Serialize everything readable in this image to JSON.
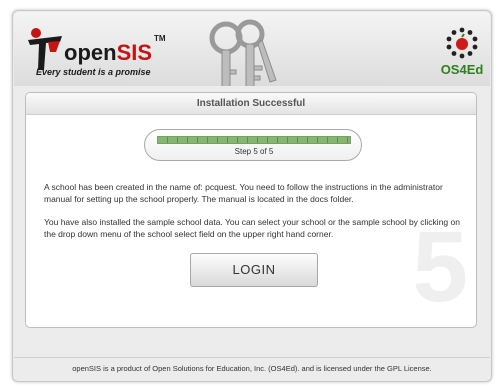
{
  "header": {
    "logo_prefix": "open",
    "logo_suffix": "SIS",
    "logo_tm": "TM",
    "tagline": "Every student is a promise",
    "partner_label": "OS4Ed"
  },
  "panel": {
    "title": "Installation Successful",
    "progress": {
      "completed_steps": 5,
      "total_steps": 5,
      "label": "Step 5 of 5"
    },
    "paragraph1": "A school has been created in the name of: pcquest. You need to follow the instructions in the administrator manual for setting up the school properly. The manual is located in the docs folder.",
    "paragraph2": "You have also installed the sample school data. You can select your school or the sample school by clicking on the drop down menu of the school select field on the upper right hand corner.",
    "big_step_number": "5",
    "login_label": "LOGIN"
  },
  "footer": {
    "text": "openSIS is a product of Open Solutions for Education, Inc. (OS4Ed). and is licensed under the GPL License."
  },
  "colors": {
    "brand_red": "#c41414",
    "progress_green": "#84b86c",
    "partner_green": "#2f7f1f"
  },
  "icons": [
    "person-logo-icon",
    "keys-icon",
    "os4ed-apple-icon"
  ]
}
